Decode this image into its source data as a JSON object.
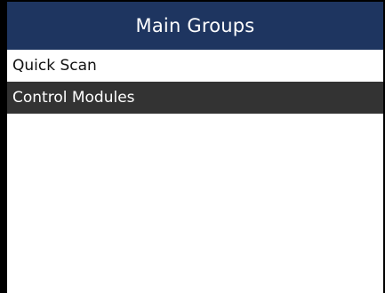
{
  "header": {
    "title": "Main Groups"
  },
  "menu": {
    "items": [
      {
        "label": "Quick Scan",
        "selected": false
      },
      {
        "label": "Control Modules",
        "selected": true
      }
    ]
  },
  "colors": {
    "header_bg": "#1e3560",
    "selected_bg": "#333333",
    "screen_bg": "#000000"
  }
}
